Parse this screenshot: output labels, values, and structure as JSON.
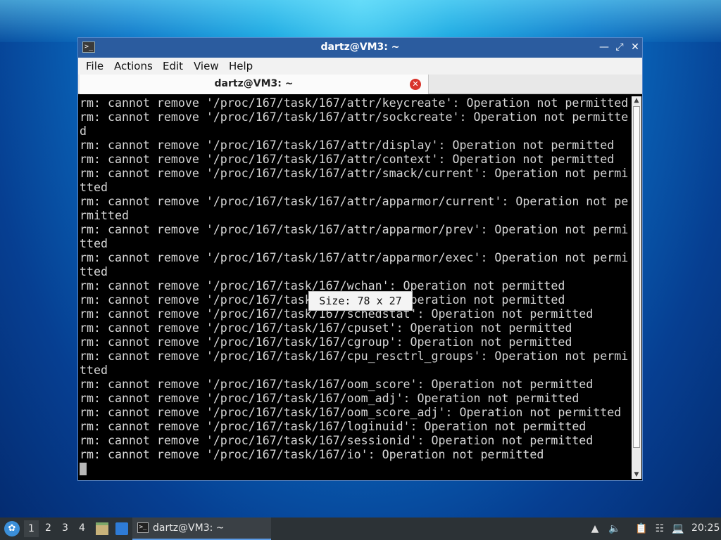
{
  "window": {
    "title": "dartz@VM3: ~",
    "app_icon": "terminal-icon",
    "controls": [
      "minimize",
      "maximize",
      "close"
    ]
  },
  "menu": {
    "file": "File",
    "actions": "Actions",
    "edit": "Edit",
    "view": "View",
    "help": "Help"
  },
  "tab": {
    "label": "dartz@VM3: ~",
    "close_icon": "close-icon",
    "close_color": "#d9342b"
  },
  "terminal": {
    "lines": [
      "rm: cannot remove '/proc/167/task/167/attr/keycreate': Operation not permitted",
      "rm: cannot remove '/proc/167/task/167/attr/sockcreate': Operation not permitte",
      "d",
      "rm: cannot remove '/proc/167/task/167/attr/display': Operation not permitted",
      "rm: cannot remove '/proc/167/task/167/attr/context': Operation not permitted",
      "rm: cannot remove '/proc/167/task/167/attr/smack/current': Operation not permi",
      "tted",
      "rm: cannot remove '/proc/167/task/167/attr/apparmor/current': Operation not pe",
      "rmitted",
      "rm: cannot remove '/proc/167/task/167/attr/apparmor/prev': Operation not permi",
      "tted",
      "rm: cannot remove '/proc/167/task/167/attr/apparmor/exec': Operation not permi",
      "tted",
      "rm: cannot remove '/proc/167/task/167/wchan': Operation not permitted",
      "rm: cannot remove '/proc/167/task/167/stack': Operation not permitted",
      "rm: cannot remove '/proc/167/task/167/schedstat': Operation not permitted",
      "rm: cannot remove '/proc/167/task/167/cpuset': Operation not permitted",
      "rm: cannot remove '/proc/167/task/167/cgroup': Operation not permitted",
      "rm: cannot remove '/proc/167/task/167/cpu_resctrl_groups': Operation not permi",
      "tted",
      "rm: cannot remove '/proc/167/task/167/oom_score': Operation not permitted",
      "rm: cannot remove '/proc/167/task/167/oom_adj': Operation not permitted",
      "rm: cannot remove '/proc/167/task/167/oom_score_adj': Operation not permitted",
      "rm: cannot remove '/proc/167/task/167/loginuid': Operation not permitted",
      "rm: cannot remove '/proc/167/task/167/sessionid': Operation not permitted",
      "rm: cannot remove '/proc/167/task/167/io': Operation not permitted"
    ],
    "text_color": "#d6d6d6",
    "background": "#000000"
  },
  "size_tooltip": "Size: 78 x 27",
  "taskbar": {
    "start_icon": "start-menu-icon",
    "workspaces": [
      "1",
      "2",
      "3",
      "4"
    ],
    "active_workspace": "1",
    "launchers": [
      "file-manager-icon",
      "show-desktop-icon"
    ],
    "task_label": "dartz@VM3: ~",
    "task_icon": "terminal-icon",
    "tray_icons": [
      "notifications-icon",
      "volume-icon",
      "clipboard-icon",
      "network-icon",
      "updates-icon"
    ],
    "clock": "20:25"
  }
}
